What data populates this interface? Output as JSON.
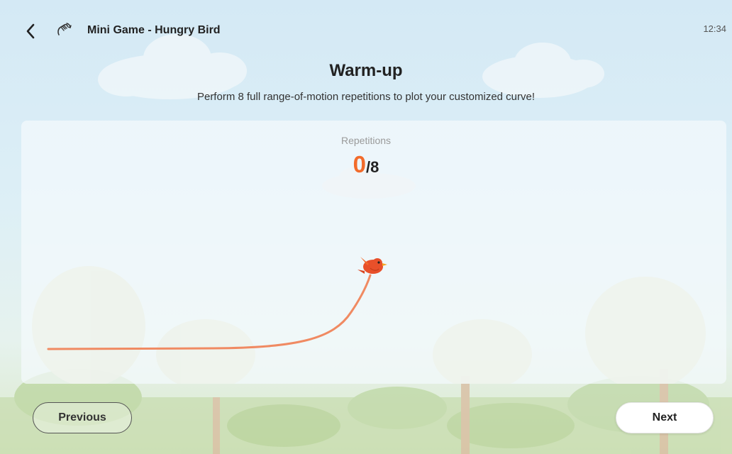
{
  "header": {
    "back_icon": "chevron-left-icon",
    "game_icon": "hand-rotate-icon",
    "title": "Mini Game - Hungry Bird",
    "time": "12:34"
  },
  "intro": {
    "heading": "Warm-up",
    "instruction": "Perform 8 full range-of-motion repetitions to plot your customized curve!"
  },
  "progress": {
    "label": "Repetitions",
    "current": "0",
    "separator": "/",
    "total": "8"
  },
  "colors": {
    "accent": "#f26b2b",
    "curve": "#f08a62",
    "bird": "#e8502a"
  },
  "footer": {
    "previous_label": "Previous",
    "next_label": "Next"
  }
}
